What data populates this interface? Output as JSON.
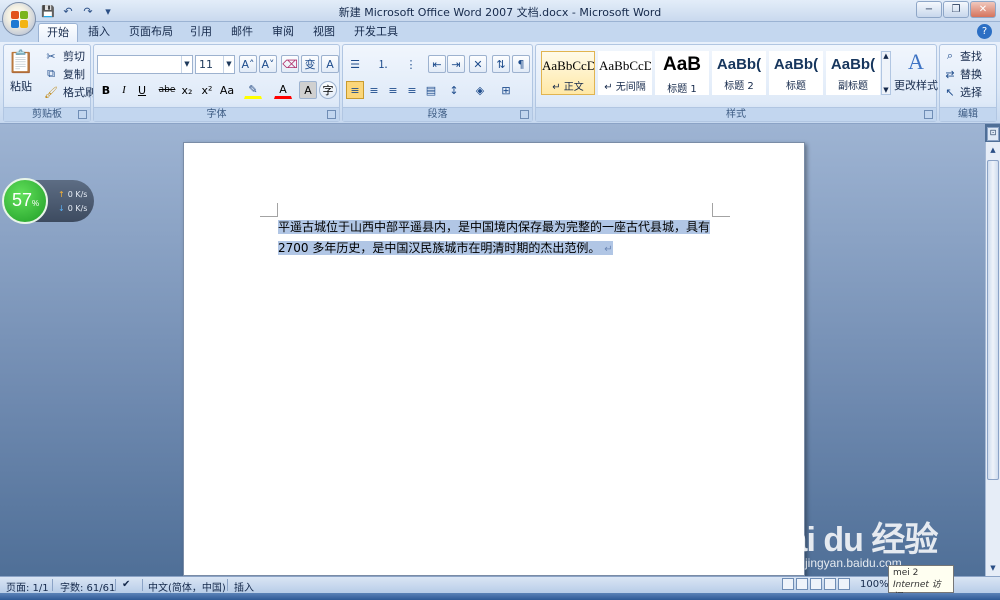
{
  "window": {
    "title": "新建 Microsoft Office Word 2007 文档.docx - Microsoft Word",
    "minimize": "−",
    "restore": "❐",
    "close": "✕"
  },
  "qat": {
    "save": "💾",
    "undo": "↶",
    "redo": "↷",
    "more": "▾"
  },
  "tabs": [
    "开始",
    "插入",
    "页面布局",
    "引用",
    "邮件",
    "审阅",
    "视图",
    "开发工具"
  ],
  "help": "?",
  "clipboard": {
    "label": "剪贴板",
    "paste": "粘贴",
    "cut": "剪切",
    "copy": "复制",
    "format_painter": "格式刷"
  },
  "font": {
    "label": "字体",
    "font_name": "",
    "font_size": "11",
    "grow": "A˄",
    "shrink": "A˅",
    "bold": "B",
    "italic": "I",
    "underline": "U",
    "strike": "abe",
    "subscript": "x₂",
    "superscript": "x²",
    "change_case": "Aa",
    "font_color": "A",
    "char_shading": "A",
    "enclose": "字",
    "phonetic": "变",
    "border": "A"
  },
  "paragraph": {
    "label": "段落"
  },
  "styles": {
    "label": "样式",
    "items": [
      {
        "sample": "AaBbCcD",
        "name": "↵ 正文"
      },
      {
        "sample": "AaBbCcD",
        "name": "↵ 无间隔"
      },
      {
        "sample": "AaB",
        "name": "标题 1"
      },
      {
        "sample": "AaBb(",
        "name": "标题 2"
      },
      {
        "sample": "AaBb(",
        "name": "标题"
      },
      {
        "sample": "AaBb(",
        "name": "副标题"
      }
    ],
    "change_styles": "更改样式"
  },
  "editing": {
    "label": "编辑",
    "find": "查找",
    "replace": "替换",
    "select": "选择"
  },
  "document": {
    "line1": "平遥古城位于山西中部平遥县内，是中国境内保存最为完整的一座古代县城，具有",
    "line2": "2700 多年历史，是中国汉民族城市在明清时期的杰出范例。",
    "para_mark": "↵"
  },
  "net_widget": {
    "percent": "57",
    "percent_sign": "%",
    "upload": "0 K/s",
    "download": "0 K/s"
  },
  "watermark": {
    "logo": "Bai du 经验",
    "site": "jingyan.baidu.com"
  },
  "status": {
    "page": "页面: 1/1",
    "words": "字数: 61/61",
    "language": "中文(简体，中国)",
    "mode": "插入",
    "zoom": "100%"
  },
  "tooltip": {
    "line1": "mei 2",
    "line2": "Internet 访问"
  }
}
